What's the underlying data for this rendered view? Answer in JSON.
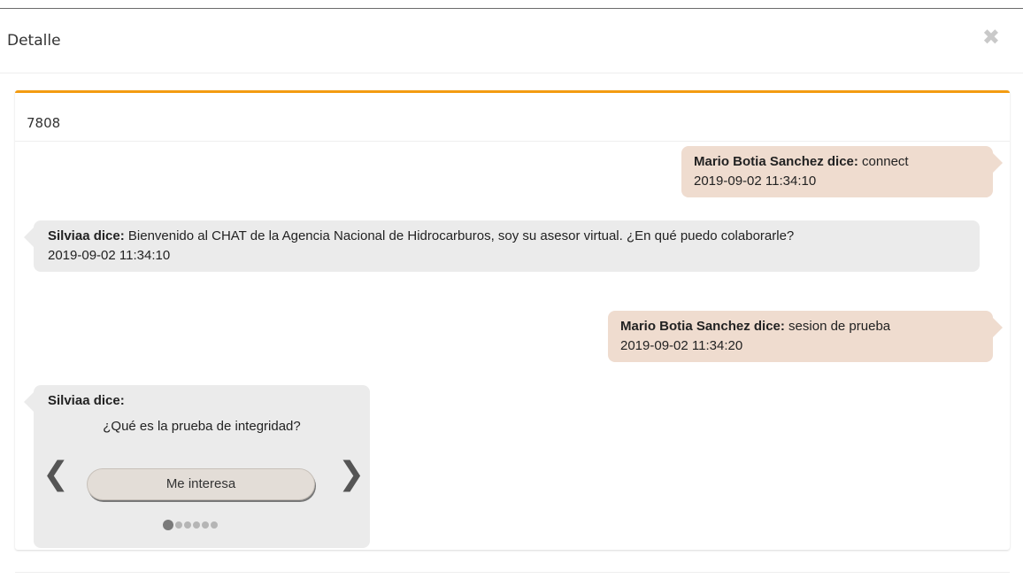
{
  "header": {
    "clipped_text": "",
    "title": "Detalle",
    "close_icon": "close-icon",
    "close_symbol": "✖"
  },
  "panel": {
    "accent_color": "#f39c12",
    "id_text": "7808"
  },
  "messages": [
    {
      "side": "right",
      "sender": "Mario Botia Sanchez dice:",
      "text": "connect",
      "timestamp": "2019-09-02 11:34:10"
    },
    {
      "side": "left",
      "sender": "Silviaa dice:",
      "text": "Bienvenido al CHAT de la Agencia Nacional de Hidrocarburos, soy su asesor virtual. ¿En qué puedo colaborarle?",
      "timestamp": "2019-09-02 11:34:10"
    },
    {
      "side": "right",
      "sender": "Mario Botia Sanchez dice:",
      "text": "sesion de prueba",
      "timestamp": "2019-09-02 11:34:20"
    }
  ],
  "carousel": {
    "sender": "Silviaa dice:",
    "question": "¿Qué es la prueba de integridad?",
    "button_label": "Me interesa",
    "prev_symbol": "❮",
    "next_symbol": "❯",
    "prev_icon": "chevron-left-icon",
    "next_icon": "chevron-right-icon",
    "dot_count": 6,
    "active_dot": 1
  },
  "colors": {
    "user_bubble": "#efdccf",
    "bot_bubble": "#ebebeb"
  }
}
